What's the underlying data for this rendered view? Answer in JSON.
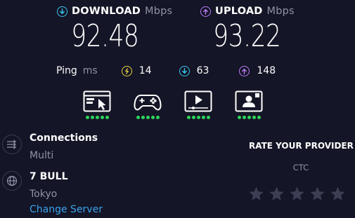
{
  "download": {
    "label": "DOWNLOAD",
    "unit": "Mbps",
    "value": "92.48",
    "color": "#37c6ef"
  },
  "upload": {
    "label": "UPLOAD",
    "unit": "Mbps",
    "value": "93.22",
    "color": "#b87cf5"
  },
  "ping": {
    "label": "Ping",
    "unit": "ms",
    "idle": {
      "icon": "ping-idle-icon",
      "value": "14",
      "color": "#ecd043"
    },
    "download": {
      "icon": "download-latency-icon",
      "value": "63",
      "color": "#37c6ef"
    },
    "upload": {
      "icon": "upload-latency-icon",
      "value": "148",
      "color": "#b87cf5"
    }
  },
  "activities": [
    {
      "icon": "web-browsing-icon",
      "rating": 5
    },
    {
      "icon": "gaming-icon",
      "rating": 5
    },
    {
      "icon": "video-streaming-icon",
      "rating": 5
    },
    {
      "icon": "video-chat-icon",
      "rating": 5
    }
  ],
  "connections": {
    "title": "Connections",
    "value": "Multi",
    "icon": "connections-icon"
  },
  "server": {
    "title": "7 BULL",
    "location": "Tokyo",
    "change_label": "Change Server",
    "icon": "globe-icon"
  },
  "rating": {
    "title": "RATE YOUR PROVIDER",
    "provider": "CTC",
    "stars": 5,
    "star_color": "#3c3e54"
  },
  "colors": {
    "background": "#141526",
    "muted": "#9193a8",
    "link": "#3aa3ef",
    "good": "#2fd35c"
  }
}
